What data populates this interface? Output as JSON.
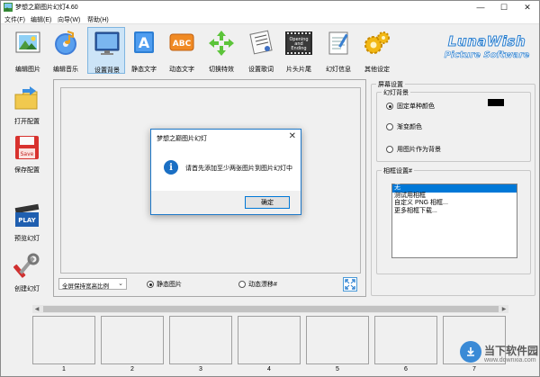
{
  "window": {
    "title": "梦想之巅图片幻灯4.60",
    "controls": {
      "minimize": "—",
      "maximize": "☐",
      "close": "✕"
    }
  },
  "menu": [
    "文件(F)",
    "编辑(E)",
    "向导(W)",
    "帮助(H)"
  ],
  "toolbar": [
    {
      "label": "编辑图片",
      "icon": "edit-picture-icon"
    },
    {
      "label": "编辑音乐",
      "icon": "music-icon"
    },
    {
      "label": "设置背景",
      "icon": "monitor-background-icon",
      "selected": true
    },
    {
      "label": "静态文字",
      "icon": "static-text-icon"
    },
    {
      "label": "动态文字",
      "icon": "dynamic-text-icon"
    },
    {
      "label": "切换特效",
      "icon": "transition-effect-icon"
    },
    {
      "label": "设置歌词",
      "icon": "lyrics-icon"
    },
    {
      "label": "片头片尾",
      "icon": "opening-ending-icon",
      "icon_text": [
        "Opening",
        "and",
        "Ending"
      ]
    },
    {
      "label": "幻灯信息",
      "icon": "slide-info-icon"
    },
    {
      "label": "其他设定",
      "icon": "other-settings-icon"
    }
  ],
  "brand": {
    "line1": "LunaWish",
    "line2": "Picture Software"
  },
  "sidebar": [
    {
      "label": "打开配置",
      "icon": "open-config-icon"
    },
    {
      "label": "保存配置",
      "icon": "save-config-icon",
      "icon_text": "Save"
    },
    {
      "label": "预览幻灯",
      "icon": "preview-play-icon",
      "icon_text": "PLAY"
    },
    {
      "label": "创建幻灯",
      "icon": "create-slideshow-icon"
    }
  ],
  "preview_controls": {
    "aspect_select": "全屏保持宽高比例",
    "radio_static": "静态图片",
    "radio_dynamic": "动态漂移#",
    "selected": "static"
  },
  "screen_settings": {
    "title": "屏幕设置",
    "background_group": {
      "title": "幻灯背景",
      "options": [
        "固定单种颜色",
        "渐变颜色",
        "用图片作为背景"
      ],
      "selected_index": 0,
      "swatch_color": "#000000"
    },
    "frame_group": {
      "title": "相框设置#",
      "items": [
        "无",
        "测试用相框",
        "自定义 PNG 相框...",
        "更多相框下载..."
      ],
      "selected_index": 0
    }
  },
  "slots": [
    "1",
    "2",
    "3",
    "4",
    "5",
    "6",
    "7"
  ],
  "dialog": {
    "title": "梦想之巅图片幻灯",
    "message": "请首先添加至少两张图片到图片幻灯中",
    "ok_label": "确定",
    "close": "✕",
    "info_glyph": "i"
  },
  "watermark": {
    "line1": "当下软件园",
    "line2": "www.downxia.com"
  },
  "colors": {
    "accent": "#0078d7",
    "brand": "#2a7fd0",
    "dialog_border": "#1e78c8"
  }
}
